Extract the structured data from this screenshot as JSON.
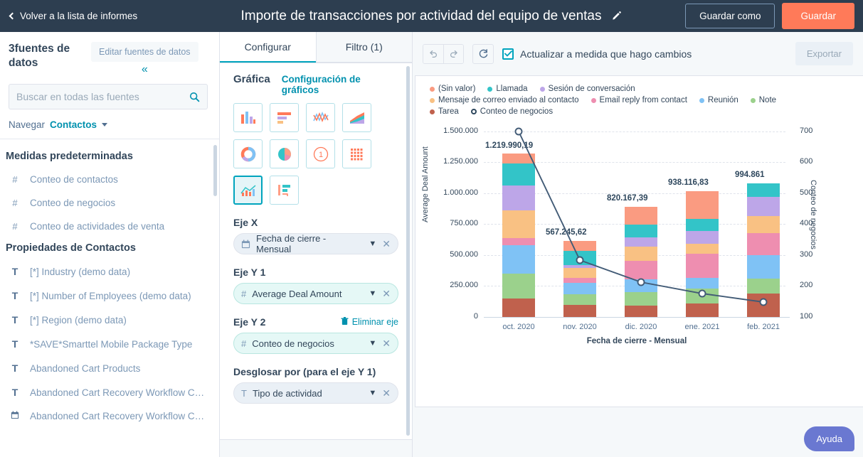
{
  "topbar": {
    "back_label": "Volver a la lista de informes",
    "title": "Importe de transacciones por actividad del equipo de ventas",
    "save_as_label": "Guardar como",
    "save_label": "Guardar",
    "accent": "#ff7a59",
    "bg": "#2d3e50"
  },
  "sidebar": {
    "sources_count_label": "3fuentes de datos",
    "edit_sources_label": "Editar fuentes de datos",
    "search_placeholder": "Buscar en todas las fuentes",
    "search_value": "",
    "navigate_label": "Navegar",
    "navigate_value": "Contactos",
    "groups": [
      {
        "title": "Medidas predeterminadas",
        "items": [
          {
            "icon": "hash-icon",
            "glyph": "#",
            "label": "Conteo de contactos"
          },
          {
            "icon": "hash-icon",
            "glyph": "#",
            "label": "Conteo de negocios"
          },
          {
            "icon": "hash-icon",
            "glyph": "#",
            "label": "Conteo de actividades de venta"
          }
        ]
      },
      {
        "title": "Propiedades de Contactos",
        "items": [
          {
            "icon": "text-icon",
            "glyph": "T",
            "label": "[*] Industry (demo data)"
          },
          {
            "icon": "text-icon",
            "glyph": "T",
            "label": "[*] Number of Employees (demo data)"
          },
          {
            "icon": "text-icon",
            "glyph": "T",
            "label": "[*] Region (demo data)"
          },
          {
            "icon": "text-icon",
            "glyph": "T",
            "label": "*SAVE*Smarttel Mobile Package Type"
          },
          {
            "icon": "text-icon",
            "glyph": "T",
            "label": "Abandoned Cart Products"
          },
          {
            "icon": "text-icon",
            "glyph": "T",
            "label": "Abandoned Cart Recovery Workflow C…"
          },
          {
            "icon": "calendar-icon",
            "glyph": "▦",
            "label": "Abandoned Cart Recovery Workflow C…"
          }
        ]
      }
    ]
  },
  "config_panel": {
    "tabs": [
      {
        "label": "Configurar",
        "active": true
      },
      {
        "label": "Filtro (1)",
        "active": false
      }
    ],
    "chart_section_label": "Gráfica",
    "chart_settings_link": "Configuración de gráficos",
    "chart_types": [
      {
        "name": "vertical-bar-chart-icon",
        "selected": false
      },
      {
        "name": "horizontal-bar-chart-icon",
        "selected": false
      },
      {
        "name": "line-chart-icon",
        "selected": false
      },
      {
        "name": "area-chart-icon",
        "selected": false
      },
      {
        "name": "donut-chart-icon",
        "selected": false
      },
      {
        "name": "pie-chart-icon",
        "selected": false
      },
      {
        "name": "single-value-icon",
        "selected": false
      },
      {
        "name": "table-chart-icon",
        "selected": false
      },
      {
        "name": "combo-chart-icon",
        "selected": true
      },
      {
        "name": "funnel-chart-icon",
        "selected": false
      }
    ],
    "x_axis": {
      "label": "Eje X",
      "value": "Fecha de cierre - Mensual",
      "icon": "calendar-icon",
      "glyph": "▦"
    },
    "y1_axis": {
      "label": "Eje Y 1",
      "value": "Average Deal Amount",
      "icon": "hash-icon",
      "glyph": "#"
    },
    "y2_axis": {
      "label": "Eje Y 2",
      "value": "Conteo de negocios",
      "icon": "hash-icon",
      "glyph": "#",
      "remove_label": "Eliminar eje"
    },
    "breakdown": {
      "label": "Desglosar por (para el eje Y 1)",
      "value": "Tipo de actividad",
      "icon": "text-icon",
      "glyph": "T"
    }
  },
  "chart_toolbar": {
    "undo_icon": "undo-icon",
    "redo_icon": "redo-icon",
    "refresh_icon": "refresh-icon",
    "autorefresh_label": "Actualizar a medida que hago cambios",
    "autorefresh_checked": true,
    "export_label": "Exportar"
  },
  "help": {
    "label": "Ayuda",
    "color": "#6a78d1"
  },
  "chart_data": {
    "type": "bar",
    "title": "",
    "xlabel": "Fecha de cierre - Mensual",
    "ylabel": "Average Deal Amount",
    "y2label": "Conteo de negocios",
    "grid": true,
    "legend_position": "top",
    "categories": [
      "oct. 2020",
      "nov. 2020",
      "dic. 2020",
      "ene. 2021",
      "feb. 2021"
    ],
    "ylim": [
      0,
      1500000
    ],
    "yticks": [
      "0",
      "250.000",
      "500.000",
      "750.000",
      "1.000.000",
      "1.250.000",
      "1.500.000"
    ],
    "y2lim": [
      100,
      700
    ],
    "y2ticks": [
      "100",
      "200",
      "300",
      "400",
      "500",
      "600",
      "700"
    ],
    "bar_totals": [
      "1.219.990,19",
      "567.245,62",
      "820.167,39",
      "938.116,83",
      "994.861"
    ],
    "bar_total_values": [
      1219990.19,
      567245.62,
      820167.39,
      938116.83,
      994861
    ],
    "series": [
      {
        "name": "(Sin valor)",
        "color": "#fa9b81",
        "values": [
          75000,
          73000,
          132000,
          207000,
          0
        ]
      },
      {
        "name": "Llamada",
        "color": "#33c4c8",
        "values": [
          163000,
          105000,
          95000,
          88000,
          101000
        ]
      },
      {
        "name": "Sesión de conversación",
        "color": "#bda6e8",
        "values": [
          185000,
          22000,
          68000,
          97000,
          142000
        ]
      },
      {
        "name": "Mensaje de correo enviado al contacto",
        "color": "#f9c183",
        "values": [
          206000,
          74000,
          107000,
          74000,
          126000
        ]
      },
      {
        "name": "Email reply from contact",
        "color": "#ee8eb0",
        "values": [
          52000,
          36000,
          138000,
          178000,
          164000
        ]
      },
      {
        "name": "Reunión",
        "color": "#7fc2f5",
        "values": [
          212000,
          86000,
          95000,
          78000,
          176000
        ]
      },
      {
        "name": "Note",
        "color": "#9bd18c",
        "values": [
          190000,
          81000,
          0,
          110000,
          109000
        ]
      },
      {
        "name": "Tarea",
        "color": "#c0614d",
        "values": [
          137000,
          90000,
          85000,
          83000,
          77000
        ]
      }
    ],
    "line_series": {
      "name": "Conteo de negocios",
      "color": "#425b76",
      "marker": "open-circle",
      "values": [
        745,
        288,
        197,
        152,
        128
      ]
    }
  }
}
